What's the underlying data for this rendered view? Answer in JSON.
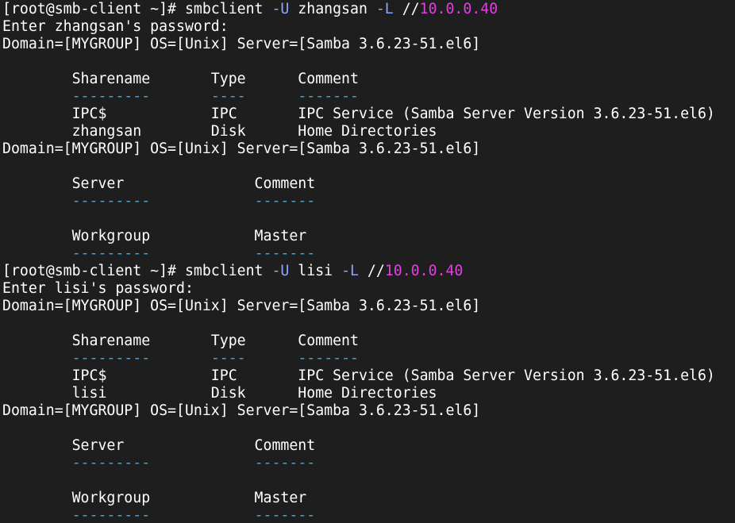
{
  "theme": {
    "background": "#1e1e1e",
    "default": "#ffffff",
    "flag": "#8fa4ff",
    "ip": "#e040e0",
    "rule": "#37a6e6"
  },
  "lines": [
    [
      {
        "t": "[root@smb-client ~]# smbclient ",
        "c": "default"
      },
      {
        "t": "-U",
        "c": "flag"
      },
      {
        "t": " zhangsan ",
        "c": "default"
      },
      {
        "t": "-L",
        "c": "flag"
      },
      {
        "t": " //",
        "c": "default"
      },
      {
        "t": "10.0.0.40",
        "c": "ip"
      }
    ],
    [
      {
        "t": "Enter zhangsan's password:",
        "c": "default"
      }
    ],
    [
      {
        "t": "Domain=[MYGROUP] OS=[Unix] Server=[Samba 3.6.23-51.el6]",
        "c": "default"
      }
    ],
    [],
    [
      {
        "t": "        Sharename       Type      Comment",
        "c": "default"
      }
    ],
    [
      {
        "t": "        ",
        "c": "default"
      },
      {
        "t": "---------",
        "c": "rule"
      },
      {
        "t": "       ",
        "c": "default"
      },
      {
        "t": "----",
        "c": "rule"
      },
      {
        "t": "      ",
        "c": "default"
      },
      {
        "t": "-------",
        "c": "rule"
      }
    ],
    [
      {
        "t": "        IPC$            IPC       IPC Service (Samba Server Version 3.6.23-51.el6)",
        "c": "default"
      }
    ],
    [
      {
        "t": "        zhangsan        Disk      Home Directories",
        "c": "default"
      }
    ],
    [
      {
        "t": "Domain=[MYGROUP] OS=[Unix] Server=[Samba 3.6.23-51.el6]",
        "c": "default"
      }
    ],
    [],
    [
      {
        "t": "        Server               Comment",
        "c": "default"
      }
    ],
    [
      {
        "t": "        ",
        "c": "default"
      },
      {
        "t": "---------",
        "c": "rule"
      },
      {
        "t": "            ",
        "c": "default"
      },
      {
        "t": "-------",
        "c": "rule"
      }
    ],
    [],
    [
      {
        "t": "        Workgroup            Master",
        "c": "default"
      }
    ],
    [
      {
        "t": "        ",
        "c": "default"
      },
      {
        "t": "---------",
        "c": "rule"
      },
      {
        "t": "            ",
        "c": "default"
      },
      {
        "t": "-------",
        "c": "rule"
      }
    ],
    [
      {
        "t": "[root@smb-client ~]# smbclient ",
        "c": "default"
      },
      {
        "t": "-U",
        "c": "flag"
      },
      {
        "t": " lisi ",
        "c": "default"
      },
      {
        "t": "-L",
        "c": "flag"
      },
      {
        "t": " //",
        "c": "default"
      },
      {
        "t": "10.0.0.40",
        "c": "ip"
      }
    ],
    [
      {
        "t": "Enter lisi's password:",
        "c": "default"
      }
    ],
    [
      {
        "t": "Domain=[MYGROUP] OS=[Unix] Server=[Samba 3.6.23-51.el6]",
        "c": "default"
      }
    ],
    [],
    [
      {
        "t": "        Sharename       Type      Comment",
        "c": "default"
      }
    ],
    [
      {
        "t": "        ",
        "c": "default"
      },
      {
        "t": "---------",
        "c": "rule"
      },
      {
        "t": "       ",
        "c": "default"
      },
      {
        "t": "----",
        "c": "rule"
      },
      {
        "t": "      ",
        "c": "default"
      },
      {
        "t": "-------",
        "c": "rule"
      }
    ],
    [
      {
        "t": "        IPC$            IPC       IPC Service (Samba Server Version 3.6.23-51.el6)",
        "c": "default"
      }
    ],
    [
      {
        "t": "        lisi            Disk      Home Directories",
        "c": "default"
      }
    ],
    [
      {
        "t": "Domain=[MYGROUP] OS=[Unix] Server=[Samba 3.6.23-51.el6]",
        "c": "default"
      }
    ],
    [],
    [
      {
        "t": "        Server               Comment",
        "c": "default"
      }
    ],
    [
      {
        "t": "        ",
        "c": "default"
      },
      {
        "t": "---------",
        "c": "rule"
      },
      {
        "t": "            ",
        "c": "default"
      },
      {
        "t": "-------",
        "c": "rule"
      }
    ],
    [],
    [
      {
        "t": "        Workgroup            Master",
        "c": "default"
      }
    ],
    [
      {
        "t": "        ",
        "c": "default"
      },
      {
        "t": "---------",
        "c": "rule"
      },
      {
        "t": "            ",
        "c": "default"
      },
      {
        "t": "-------",
        "c": "rule"
      }
    ]
  ]
}
